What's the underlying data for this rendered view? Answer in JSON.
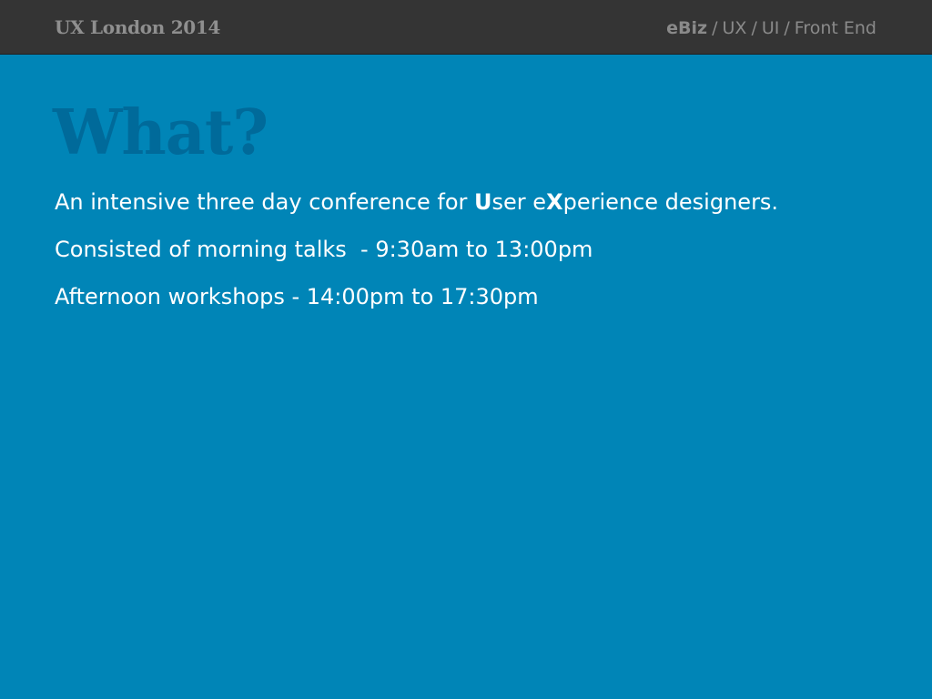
{
  "header": {
    "event_title": "UX London 2014",
    "breadcrumb": {
      "first": "eBiz",
      "separator": "/",
      "rest": [
        "UX",
        "UI",
        "Front End"
      ]
    }
  },
  "slide": {
    "title": "What?",
    "lines": {
      "line1": {
        "part1": "An intensive three day conference for ",
        "strong1": "U",
        "part2": "ser e",
        "strong2": "X",
        "part3": "perience designers."
      },
      "line2": "Consisted of morning talks  - 9:30am to 13:00pm",
      "line3": "Afternoon workshops - 14:00pm to 17:30pm"
    }
  }
}
